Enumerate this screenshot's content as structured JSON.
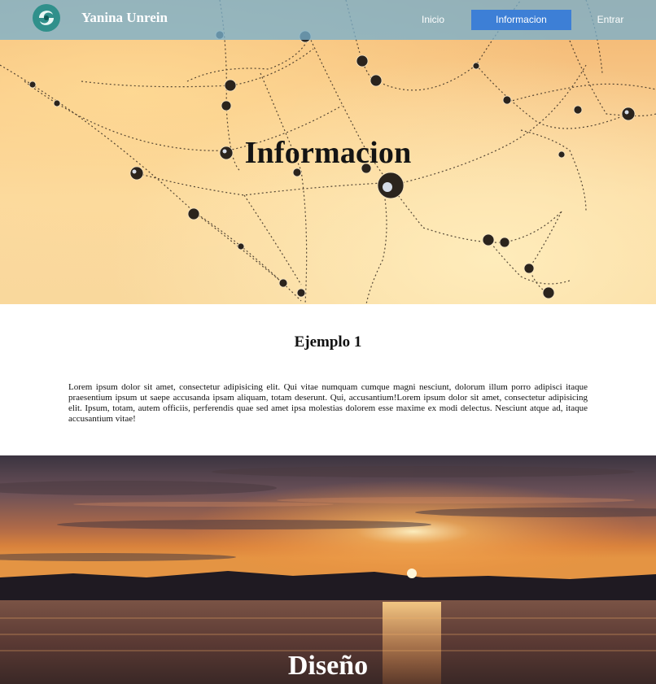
{
  "colors": {
    "navbar_bg": "#78afcd",
    "active_nav_bg": "#3d7fd6",
    "nav_text": "#ffffff",
    "hero_title_text": "#141414",
    "section_text": "#111111",
    "sunset_title_text": "#ffffff"
  },
  "header": {
    "logo_icon": "swirl-logo-icon",
    "brand": "Yanina Unrein",
    "nav": [
      {
        "label": "Inicio",
        "active": false
      },
      {
        "label": "Informacion",
        "active": true
      },
      {
        "label": "Entrar",
        "active": false
      }
    ]
  },
  "hero": {
    "title": "Informacion"
  },
  "section": {
    "title": "Ejemplo 1",
    "text": "Lorem ipsum dolor sit amet, consectetur adipisicing elit. Qui vitae numquam cumque magni nesciunt, dolorum illum porro adipisci itaque praesentium ipsum ut saepe accusanda ipsam aliquam, totam deserunt. Qui, accusantium!Lorem ipsum dolor sit amet, consectetur adipisicing elit. Ipsum, totam, autem officiis, perferendis quae sed amet ipsa molestias dolorem esse maxime ex modi delectus. Nesciunt atque ad, itaque accusantium vitae!"
  },
  "second_hero": {
    "title": "Diseño"
  }
}
